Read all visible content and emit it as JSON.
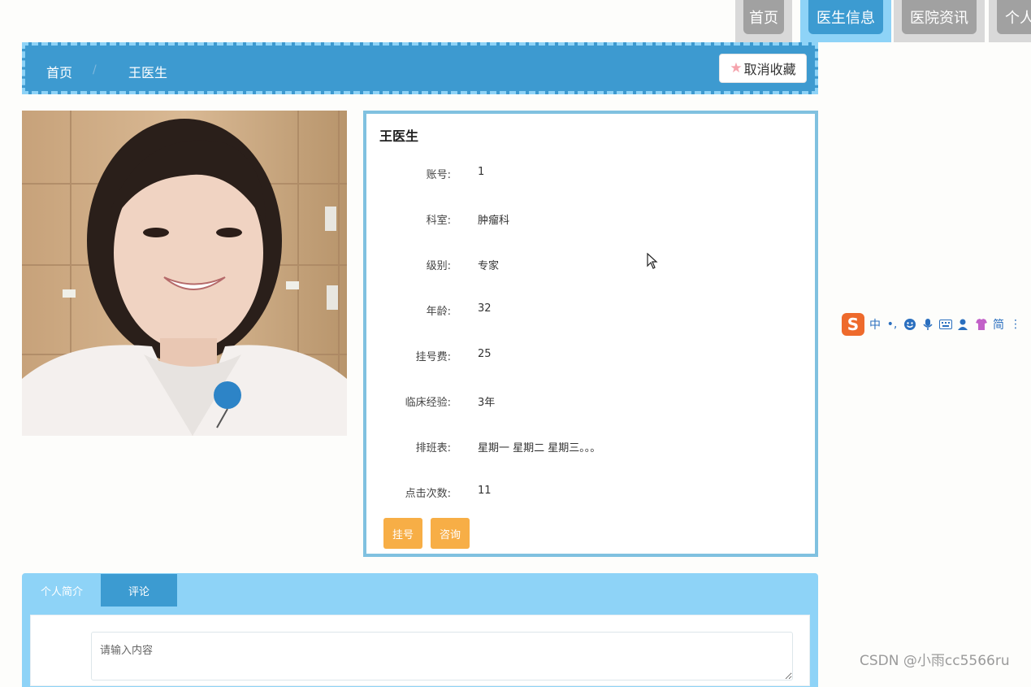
{
  "nav": {
    "tabs": [
      {
        "label": "首页",
        "active": false
      },
      {
        "label": "医生信息",
        "active": true
      },
      {
        "label": "医院资讯",
        "active": false
      },
      {
        "label": "个人",
        "active": false
      }
    ]
  },
  "breadcrumb": {
    "home": "首页",
    "separator": "/",
    "current": "王医生",
    "favorite_label": "取消收藏"
  },
  "doctor": {
    "name": "王医生",
    "fields": [
      {
        "label": "账号:",
        "value": "1"
      },
      {
        "label": "科室:",
        "value": "肿瘤科"
      },
      {
        "label": "级别:",
        "value": "专家"
      },
      {
        "label": "年龄:",
        "value": "32"
      },
      {
        "label": "挂号费:",
        "value": "25"
      },
      {
        "label": "临床经验:",
        "value": "3年"
      },
      {
        "label": "排班表:",
        "value": "星期一 星期二 星期三。。。"
      },
      {
        "label": "点击次数:",
        "value": "11"
      }
    ],
    "register_label": "挂号",
    "consult_label": "咨询"
  },
  "bottom_tabs": {
    "tabs": [
      {
        "label": "个人简介",
        "active": false
      },
      {
        "label": "评论",
        "active": true
      }
    ],
    "comment_placeholder": "请输入内容"
  },
  "ime": {
    "logo": "S",
    "mode": "中",
    "script": "简"
  },
  "watermark": "CSDN @小雨cc5566ru",
  "colors": {
    "primary": "#3c9bd1",
    "light": "#8ed3f7",
    "orange": "#f7ae46",
    "gray": "#a1a1a1"
  }
}
